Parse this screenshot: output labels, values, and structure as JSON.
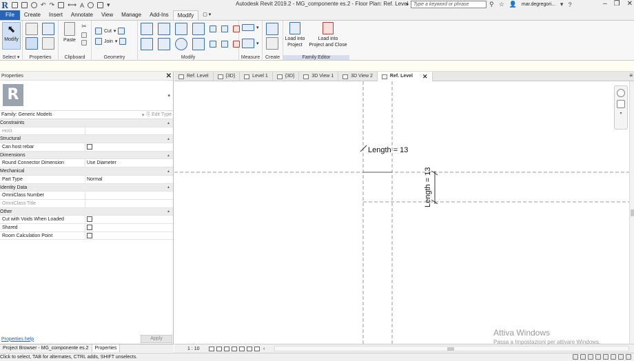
{
  "window": {
    "title": "Autodesk Revit 2019.2 - MG_componente es.2 - Floor Plan: Ref. Level",
    "search_placeholder": "Type a keyword or phrase",
    "user_name": "mar.degregori..."
  },
  "ribbon_tabs": [
    "File",
    "Create",
    "Insert",
    "Annotate",
    "View",
    "Manage",
    "Add-Ins",
    "Modify",
    "▢ ▾"
  ],
  "ribbon": {
    "modify_label": "Modify",
    "groups": {
      "select": "Select ▾",
      "properties": "Properties",
      "clipboard": "Clipboard",
      "geometry": "Geometry",
      "modify": "Modify",
      "measure": "Measure",
      "create": "Create",
      "family_editor": "Family Editor"
    },
    "paste_label": "Paste",
    "cut_label": "Cut",
    "join_label": "Join",
    "load_into_project": "Load into\nProject",
    "load_into_project_close": "Load into\nProject and Close"
  },
  "properties": {
    "title": "Properties",
    "family": "Family: Generic Models",
    "edit_type": "Edit Type",
    "rows": [
      {
        "type": "cat",
        "label": "Constraints"
      },
      {
        "type": "prop",
        "label": "Host",
        "value": "",
        "grey": true
      },
      {
        "type": "cat",
        "label": "Structural"
      },
      {
        "type": "prop",
        "label": "Can host rebar",
        "checkbox": true
      },
      {
        "type": "cat",
        "label": "Dimensions"
      },
      {
        "type": "prop",
        "label": "Round Connector Dimension",
        "value": "Use Diameter"
      },
      {
        "type": "cat",
        "label": "Mechanical"
      },
      {
        "type": "prop",
        "label": "Part Type",
        "value": "Normal"
      },
      {
        "type": "cat",
        "label": "Identity Data"
      },
      {
        "type": "prop",
        "label": "OmniClass Number",
        "value": ""
      },
      {
        "type": "prop",
        "label": "OmniClass Title",
        "value": "",
        "grey": true
      },
      {
        "type": "cat",
        "label": "Other"
      },
      {
        "type": "prop",
        "label": "Cut with Voids When Loaded",
        "checkbox": true
      },
      {
        "type": "prop",
        "label": "Shared",
        "checkbox": true
      },
      {
        "type": "prop",
        "label": "Room Calculation Point",
        "checkbox": true
      }
    ],
    "help_link": "Properties help",
    "apply": "Apply"
  },
  "bottom_tabs": [
    "Project Browser - MG_componente es.2",
    "Properties"
  ],
  "status_text": "Click to select, TAB for alternates, CTRL adds, SHIFT unselects.",
  "view_tabs": [
    {
      "label": "Ref. Level",
      "active": false
    },
    {
      "label": "{3D}",
      "active": false
    },
    {
      "label": "Level 1",
      "active": false
    },
    {
      "label": "{3D}",
      "active": false
    },
    {
      "label": "3D View 1",
      "active": false
    },
    {
      "label": "3D View 2",
      "active": false
    },
    {
      "label": "Ref. Level",
      "active": true
    }
  ],
  "canvas": {
    "dim_horizontal": "Length = 13",
    "dim_vertical": "Length = 13"
  },
  "view_scale": "1 : 10",
  "watermark": {
    "line1": "Attiva Windows",
    "line2": "Passa a Impostazioni per attivare Windows."
  },
  "colors": {
    "file_tab": "#2a64b8",
    "family_editor_band": "#d8dcef"
  }
}
